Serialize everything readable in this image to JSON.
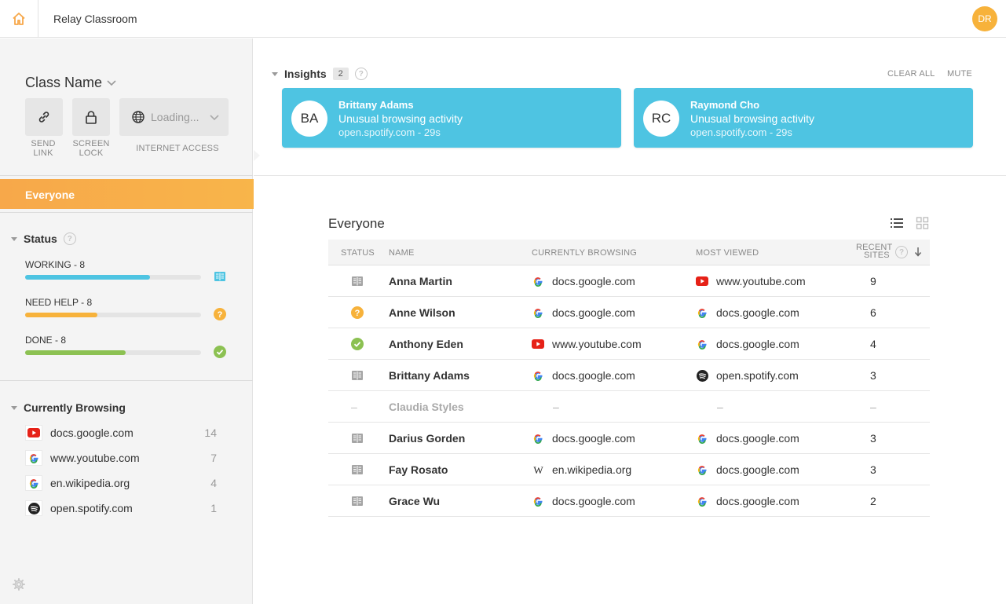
{
  "app": {
    "title": "Relay Classroom",
    "user_initials": "DR"
  },
  "sidebar": {
    "class_name": "Class Name",
    "tools": {
      "send_link": "SEND\nLINK",
      "screen_lock": "SCREEN\nLOCK",
      "internet_access_label": "INTERNET ACCESS",
      "internet_access_value": "Loading..."
    },
    "everyone": "Everyone",
    "status": {
      "title": "Status",
      "rows": [
        {
          "label": "WORKING - 8",
          "fill": 0.71,
          "color": "#4ec4e2",
          "icon": "book-icon"
        },
        {
          "label": "NEED HELP - 8",
          "fill": 0.41,
          "color": "#f7b23b",
          "icon": "question-icon"
        },
        {
          "label": "DONE - 8",
          "fill": 0.57,
          "color": "#8cc152",
          "icon": "check-icon"
        }
      ]
    },
    "browsing": {
      "title": "Currently Browsing",
      "items": [
        {
          "site": "docs.google.com",
          "count": "14",
          "icon": "youtube-icon"
        },
        {
          "site": "www.youtube.com",
          "count": "7",
          "icon": "google-icon"
        },
        {
          "site": "en.wikipedia.org",
          "count": "4",
          "icon": "google-icon"
        },
        {
          "site": "open.spotify.com",
          "count": "1",
          "icon": "spotify-icon"
        }
      ]
    }
  },
  "insights": {
    "title": "Insights",
    "count": "2",
    "clear_all": "CLEAR ALL",
    "mute": "MUTE",
    "cards": [
      {
        "initials": "BA",
        "name": "Brittany Adams",
        "message": "Unusual browsing activity",
        "detail": "open.spotify.com - 29s"
      },
      {
        "initials": "RC",
        "name": "Raymond Cho",
        "message": "Unusual browsing activity",
        "detail": "open.spotify.com - 29s"
      }
    ]
  },
  "table": {
    "title": "Everyone",
    "headers": {
      "status": "STATUS",
      "name": "NAME",
      "browsing": "CURRENTLY BROWSING",
      "most_viewed": "MOST VIEWED",
      "recent_1": "RECENT",
      "recent_2": "SITES"
    },
    "rows": [
      {
        "status": "book",
        "name": "Anna Martin",
        "browsing": "docs.google.com",
        "browsing_icon": "google",
        "most": "www.youtube.com",
        "most_icon": "youtube",
        "recent": "9"
      },
      {
        "status": "help",
        "name": "Anne Wilson",
        "browsing": "docs.google.com",
        "browsing_icon": "google",
        "most": "docs.google.com",
        "most_icon": "google",
        "recent": "6"
      },
      {
        "status": "done",
        "name": "Anthony Eden",
        "browsing": "www.youtube.com",
        "browsing_icon": "youtube",
        "most": "docs.google.com",
        "most_icon": "google",
        "recent": "4"
      },
      {
        "status": "book",
        "name": "Brittany Adams",
        "browsing": "docs.google.com",
        "browsing_icon": "google",
        "most": "open.spotify.com",
        "most_icon": "spotify",
        "recent": "3"
      },
      {
        "status": "none",
        "name": "Claudia Styles",
        "browsing": "–",
        "browsing_icon": "",
        "most": "–",
        "most_icon": "",
        "recent": "–",
        "offline": true
      },
      {
        "status": "book",
        "name": "Darius Gorden",
        "browsing": "docs.google.com",
        "browsing_icon": "google",
        "most": "docs.google.com",
        "most_icon": "google",
        "recent": "3"
      },
      {
        "status": "book",
        "name": "Fay Rosato",
        "browsing": "en.wikipedia.org",
        "browsing_icon": "wikipedia",
        "most": "docs.google.com",
        "most_icon": "google",
        "recent": "3"
      },
      {
        "status": "book",
        "name": "Grace Wu",
        "browsing": "docs.google.com",
        "browsing_icon": "google",
        "most": "docs.google.com",
        "most_icon": "google",
        "recent": "2"
      }
    ]
  }
}
